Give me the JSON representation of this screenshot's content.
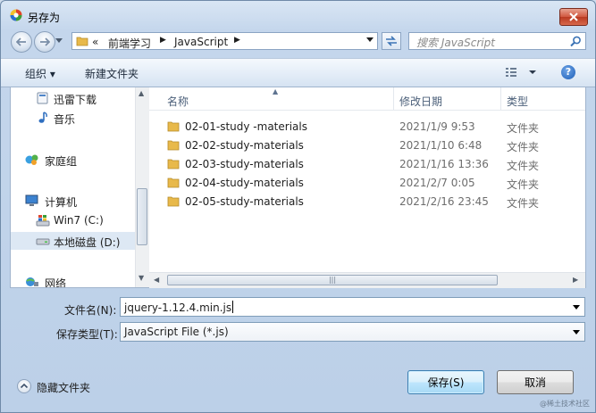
{
  "window": {
    "title": "另存为"
  },
  "address": {
    "overflow": "«",
    "path": [
      "前端学习",
      "JavaScript"
    ],
    "search_placeholder": "搜索 JavaScript"
  },
  "toolbar": {
    "organize": "组织 ▾",
    "new_folder": "新建文件夹"
  },
  "nav": {
    "items": [
      {
        "label": "迅雷下载",
        "icon": "thunder-download-icon"
      },
      {
        "label": "音乐",
        "icon": "music-icon"
      },
      {
        "label": "家庭组",
        "icon": "homegroup-icon"
      },
      {
        "label": "计算机",
        "icon": "computer-icon"
      },
      {
        "label": "Win7 (C:)",
        "icon": "drive-c-icon"
      },
      {
        "label": "本地磁盘 (D:)",
        "icon": "drive-d-icon",
        "selected": true
      },
      {
        "label": "网络",
        "icon": "network-icon"
      }
    ]
  },
  "list": {
    "columns": [
      "名称",
      "修改日期",
      "类型"
    ],
    "rows": [
      {
        "name": "02-01-study -materials",
        "date": "2021/1/9 9:53",
        "type": "文件夹"
      },
      {
        "name": "02-02-study-materials",
        "date": "2021/1/10 6:48",
        "type": "文件夹"
      },
      {
        "name": "02-03-study-materials",
        "date": "2021/1/16 13:36",
        "type": "文件夹"
      },
      {
        "name": "02-04-study-materials",
        "date": "2021/2/7 0:05",
        "type": "文件夹"
      },
      {
        "name": "02-05-study-materials",
        "date": "2021/2/16 23:45",
        "type": "文件夹"
      }
    ]
  },
  "form": {
    "filename_label": "文件名(N):",
    "filename_value": "jquery-1.12.4.min.js",
    "filetype_label": "保存类型(T):",
    "filetype_value": "JavaScript File (*.js)"
  },
  "footer": {
    "hide_folders": "隐藏文件夹",
    "save": "保存(S)",
    "cancel": "取消",
    "watermark": "@稀土技术社区"
  },
  "colors": {
    "selection": "#dde8f4",
    "folder": "#e8b94a",
    "close": "#c9452c"
  }
}
